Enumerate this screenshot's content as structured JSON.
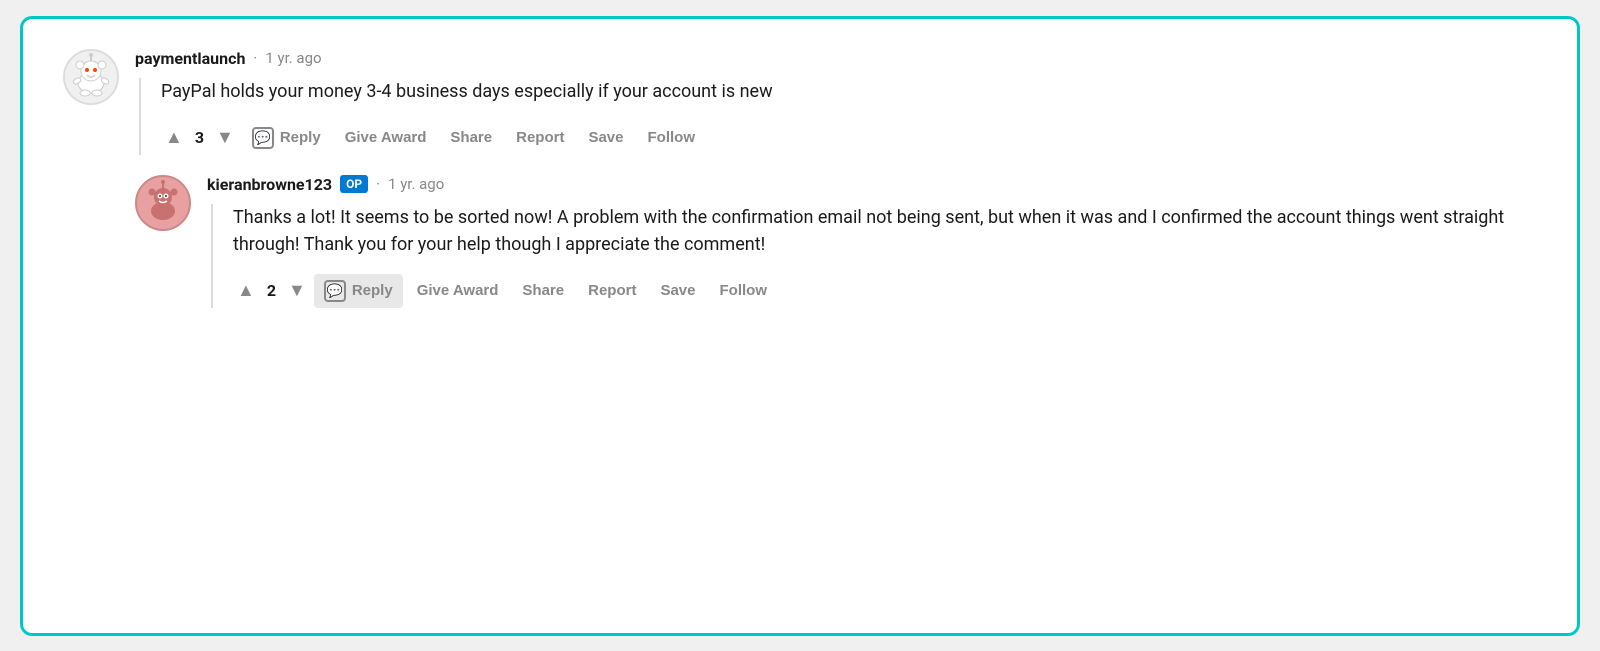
{
  "comments": [
    {
      "id": "comment-1",
      "username": "paymentlaunch",
      "timestamp": "1 yr. ago",
      "is_op": false,
      "avatar_type": "reddit",
      "vote_count": "3",
      "text": "PayPal holds your money 3-4 business days especially if your account is new",
      "actions": [
        "Reply",
        "Give Award",
        "Share",
        "Report",
        "Save",
        "Follow"
      ]
    },
    {
      "id": "comment-2",
      "username": "kieranbrowne123",
      "op_label": "OP",
      "timestamp": "1 yr. ago",
      "is_op": true,
      "avatar_type": "op",
      "vote_count": "2",
      "text": "Thanks a lot! It seems to be sorted now! A problem with the confirmation email not being sent, but when it was and I confirmed the account things went straight through! Thank you for your help though I appreciate the comment!",
      "actions": [
        "Reply",
        "Give Award",
        "Share",
        "Report",
        "Save",
        "Follow"
      ],
      "reply_highlighted": true
    }
  ],
  "ui": {
    "upvote_symbol": "▲",
    "downvote_symbol": "▼",
    "separator": "·",
    "dot_separator": "·"
  }
}
